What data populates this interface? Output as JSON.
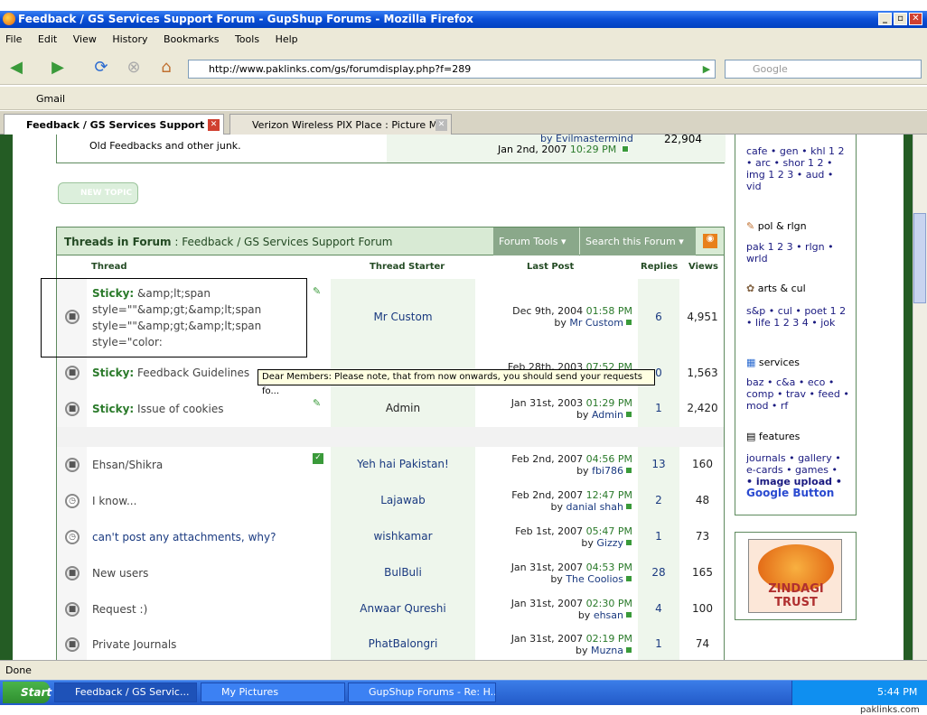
{
  "window": {
    "title": "Feedback / GS Services Support Forum - GupShup Forums - Mozilla Firefox"
  },
  "menu": [
    "File",
    "Edit",
    "View",
    "History",
    "Bookmarks",
    "Tools",
    "Help"
  ],
  "address": {
    "url": "http://www.paklinks.com/gs/forumdisplay.php?f=289",
    "search_placeholder": "Google"
  },
  "bookmarks": [
    "Gmail"
  ],
  "tabs": [
    {
      "label": "Feedback / GS Services Support ..."
    },
    {
      "label": "Verizon Wireless PIX Place : Picture M..."
    }
  ],
  "prev_forum": {
    "desc": "Old Feedbacks and other junk.",
    "by": "by Evilmastermind",
    "date": "Jan 2nd, 2007",
    "time": "10:29 PM",
    "views": "22,904"
  },
  "new_topic": "NEW TOPIC",
  "forum": {
    "prefix": "Threads in Forum",
    "name": ": Feedback / GS Services Support Forum",
    "tools": "Forum Tools",
    "search": "Search this Forum"
  },
  "columns": {
    "thread": "Thread",
    "starter": "Thread Starter",
    "lastpost": "Last Post",
    "replies": "Replies",
    "views": "Views"
  },
  "threads": [
    {
      "sticky": "Sticky:",
      "title": "&amp;lt;span style=\"\"&amp;gt;&amp;lt;span style=\"\"&amp;gt;&amp;lt;span style=\"color:",
      "starter": "Mr Custom",
      "date": "Dec 9th, 2004",
      "time": "01:58 PM",
      "by": "Mr Custom",
      "replies": "6",
      "views": "4,951"
    },
    {
      "sticky": "Sticky:",
      "title": "Feedback Guidelines",
      "starter": "",
      "date": "Feb 28th, 2003",
      "time": "07:52 PM",
      "by": "",
      "replies": "0",
      "views": "1,563"
    },
    {
      "sticky": "Sticky:",
      "title": "Issue of cookies",
      "starter": "Admin",
      "date": "Jan 31st, 2003",
      "time": "01:29 PM",
      "by": "Admin",
      "replies": "1",
      "views": "2,420"
    },
    {
      "sticky": "",
      "title": "Ehsan/Shikra",
      "starter": "Yeh hai Pakistan!",
      "date": "Feb 2nd, 2007",
      "time": "04:56 PM",
      "by": "fbi786",
      "replies": "13",
      "views": "160"
    },
    {
      "sticky": "",
      "title": "I know...",
      "starter": "Lajawab",
      "date": "Feb 2nd, 2007",
      "time": "12:47 PM",
      "by": "danial shah",
      "replies": "2",
      "views": "48"
    },
    {
      "sticky": "",
      "title": "can't post any attachments, why?",
      "starter": "wishkamar",
      "date": "Feb 1st, 2007",
      "time": "05:47 PM",
      "by": "Gizzy",
      "replies": "1",
      "views": "73"
    },
    {
      "sticky": "",
      "title": "New users",
      "starter": "BulBuli",
      "date": "Jan 31st, 2007",
      "time": "04:53 PM",
      "by": "The Coolios",
      "replies": "28",
      "views": "165"
    },
    {
      "sticky": "",
      "title": "Request :)",
      "starter": "Anwaar Qureshi",
      "date": "Jan 31st, 2007",
      "time": "02:30 PM",
      "by": "ehsan",
      "replies": "4",
      "views": "100"
    },
    {
      "sticky": "",
      "title": "Private Journals",
      "starter": "PhatBalongri",
      "date": "Jan 31st, 2007",
      "time": "02:19 PM",
      "by": "Muzna",
      "replies": "1",
      "views": "74"
    }
  ],
  "tooltip": "Dear Members: Please note, that from now onwards, you should send your requests fo...",
  "sidebar": {
    "s1": "cafe • gen • khl 1 2 • arc • shor 1 2 • img 1 2 3 • aud • vid",
    "h2": "pol & rlgn",
    "s2": "pak 1 2 3 • rlgn • wrld",
    "h3": "arts & cul",
    "s3": "s&p • cul • poet 1 2 • life 1 2 3 4 • jok",
    "h4": "services",
    "s4": "baz • c&a • eco • comp • trav • feed • mod • rf",
    "h5": "features",
    "s5": "journals • gallery • e-cards • games •",
    "s5b": "• image upload •",
    "google": "Google Button"
  },
  "zindagi": "ZINDAGI TRUST",
  "status": "Done",
  "taskbar": {
    "start": "Start",
    "items": [
      "Feedback / GS Servic...",
      "My Pictures",
      "GupShup Forums - Re: H..."
    ],
    "clock": "5:44 PM"
  },
  "watermark": "paklinks.com"
}
